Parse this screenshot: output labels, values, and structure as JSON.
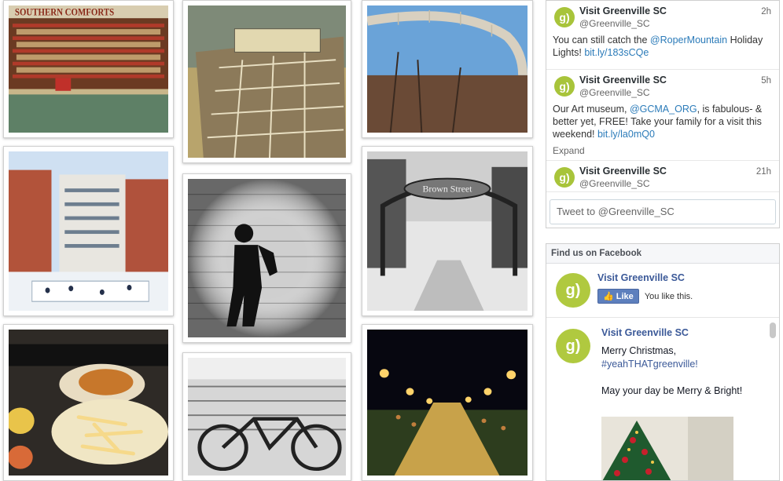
{
  "photos": [
    {
      "name": "photo-southern-comforts-shop",
      "sign_text": "SOUTHERN COMFORTS"
    },
    {
      "name": "photo-vintage-city-map"
    },
    {
      "name": "photo-liberty-bridge"
    },
    {
      "name": "photo-ice-rink-hotel"
    },
    {
      "name": "photo-saxophone-silhouette"
    },
    {
      "name": "photo-brown-street-arch",
      "sign_text": "Brown Street"
    },
    {
      "name": "photo-food-fries-sandwich"
    },
    {
      "name": "photo-bicycle-railing"
    },
    {
      "name": "photo-main-street-lights"
    }
  ],
  "twitter": {
    "tweets": [
      {
        "name": "Visit Greenville SC",
        "handle": "@Greenville_SC",
        "time": "2h",
        "text_before": "You can still catch the ",
        "mention": "@RoperMountain",
        "text_after": " Holiday Lights! ",
        "link": "bit.ly/183sCQe"
      },
      {
        "name": "Visit Greenville SC",
        "handle": "@Greenville_SC",
        "time": "5h",
        "text_before": "Our Art museum, ",
        "mention": "@GCMA_ORG",
        "text_after": ", is fabulous- & better yet, FREE! Take your family for a visit this weekend! ",
        "link": "bit.ly/la0mQ0",
        "expand": "Expand"
      },
      {
        "name": "Visit Greenville SC",
        "handle": "@Greenville_SC",
        "time": "21h"
      }
    ],
    "avatar_glyph": "g)",
    "compose_placeholder": "Tweet to @Greenville_SC"
  },
  "facebook": {
    "header": "Find us on Facebook",
    "page_name": "Visit Greenville SC",
    "like_label": "Like",
    "like_status": "You like this.",
    "avatar_glyph": "g)",
    "post": {
      "author": "Visit Greenville SC",
      "line1": "Merry Christmas,",
      "hashtag": "#yeahTHATgreenville!",
      "line2": "May your day be Merry & Bright!"
    }
  },
  "colors": {
    "brand_green": "#a8c43a",
    "link_blue": "#2b7bb9",
    "facebook_blue": "#3b5998"
  }
}
